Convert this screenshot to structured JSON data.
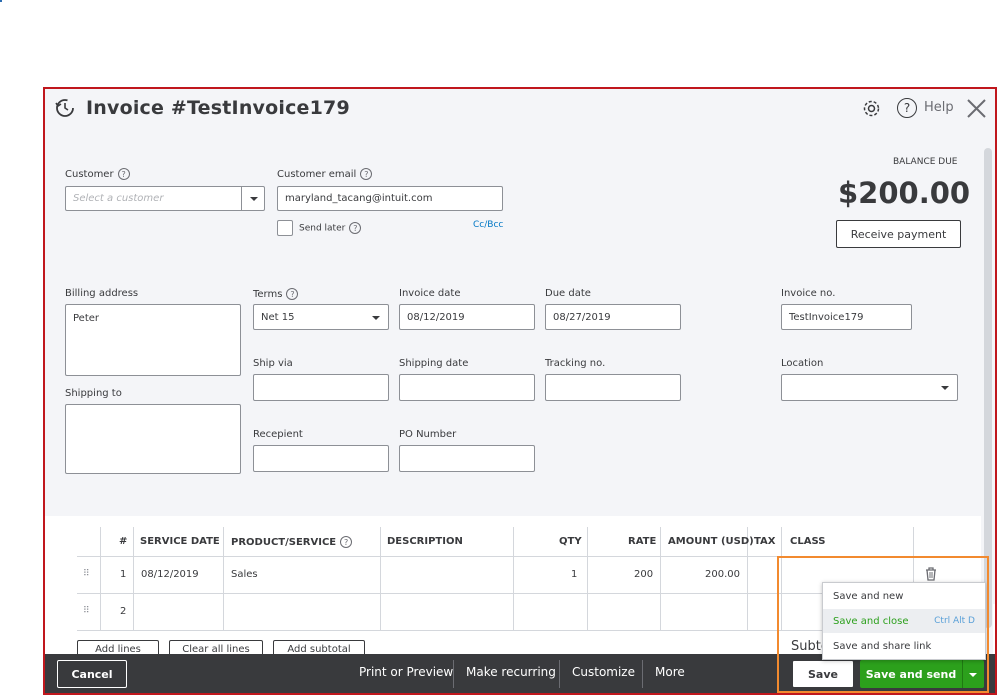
{
  "header": {
    "title": "Invoice #TestInvoice179",
    "help_label": "Help",
    "icons": [
      "history-icon",
      "gear-icon",
      "help-icon",
      "close-icon"
    ]
  },
  "customer": {
    "label": "Customer",
    "placeholder": "Select a customer"
  },
  "email": {
    "label": "Customer email",
    "value": "maryland_tacang@intuit.com",
    "send_later_label": "Send later",
    "ccbcc_link": "Cc/Bcc"
  },
  "balance": {
    "label": "BALANCE DUE",
    "amount": "$200.00",
    "receive_payment": "Receive payment"
  },
  "billing": {
    "label": "Billing address",
    "value": "Peter"
  },
  "shipping_to": {
    "label": "Shipping to",
    "value": ""
  },
  "terms": {
    "label": "Terms",
    "value": "Net 15"
  },
  "invoice_date": {
    "label": "Invoice date",
    "value": "08/12/2019"
  },
  "due_date": {
    "label": "Due date",
    "value": "08/27/2019"
  },
  "invoice_no": {
    "label": "Invoice no.",
    "value": "TestInvoice179"
  },
  "ship_via": {
    "label": "Ship via",
    "value": ""
  },
  "shipping_date": {
    "label": "Shipping date",
    "value": ""
  },
  "tracking_no": {
    "label": "Tracking no.",
    "value": ""
  },
  "location": {
    "label": "Location",
    "value": ""
  },
  "recepient": {
    "label": "Recepient",
    "value": ""
  },
  "po_number": {
    "label": "PO Number",
    "value": ""
  },
  "table": {
    "columns": [
      "#",
      "SERVICE DATE",
      "PRODUCT/SERVICE",
      "DESCRIPTION",
      "QTY",
      "RATE",
      "AMOUNT (USD)",
      "TAX",
      "CLASS"
    ],
    "rows": [
      {
        "num": "1",
        "service_date": "08/12/2019",
        "product": "Sales",
        "description": "",
        "qty": "1",
        "rate": "200",
        "amount": "200.00",
        "tax": "",
        "class": ""
      },
      {
        "num": "2",
        "service_date": "",
        "product": "",
        "description": "",
        "qty": "",
        "rate": "",
        "amount": "",
        "tax": "",
        "class": ""
      }
    ],
    "add_lines": "Add lines",
    "clear_all_lines": "Clear all lines",
    "add_subtotal": "Add subtotal",
    "subtotal_partial": "Subto"
  },
  "footer": {
    "cancel": "Cancel",
    "print_preview": "Print or Preview",
    "make_recurring": "Make recurring",
    "customize": "Customize",
    "more": "More",
    "save": "Save",
    "save_and_send": "Save and send"
  },
  "save_menu": {
    "items": [
      {
        "label": "Save and new",
        "shortcut": ""
      },
      {
        "label": "Save and close",
        "shortcut": "Ctrl Alt D"
      },
      {
        "label": "Save and share link",
        "shortcut": ""
      }
    ]
  },
  "colors": {
    "frame_highlight": "#c0171d",
    "menu_highlight": "#f28a2f",
    "primary_green": "#2ca01c",
    "footer_bg": "#393a3d",
    "link_blue": "#0077c5"
  }
}
